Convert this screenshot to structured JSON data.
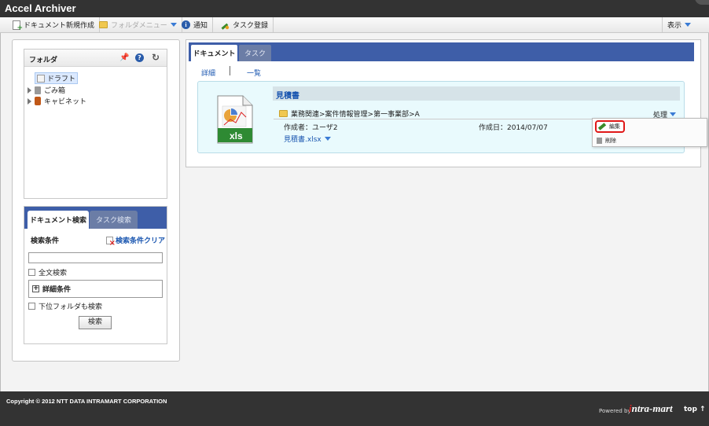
{
  "app": {
    "title": "Accel Archiver"
  },
  "toolbar": {
    "new_document": "ドキュメント新規作成",
    "folder_menu": "フォルダメニュー",
    "notify": "通知",
    "task_register": "タスク登録",
    "display": "表示"
  },
  "folder_panel": {
    "title": "フォルダ",
    "items": [
      {
        "label": "ドラフト",
        "selected": true
      },
      {
        "label": "ごみ箱"
      },
      {
        "label": "キャビネット"
      }
    ]
  },
  "search_panel": {
    "tabs": [
      "ドキュメント検索",
      "タスク検索"
    ],
    "condition_label": "検索条件",
    "clear_label": "検索条件クリア",
    "input_value": "",
    "fulltext_label": "全文検索",
    "detail_label": "詳細条件",
    "subfolder_label": "下位フォルダも検索",
    "search_button": "検索"
  },
  "content": {
    "tabs": [
      "ドキュメント",
      "タスク"
    ],
    "view_detail": "詳細",
    "view_list": "一覧",
    "document": {
      "title": "見積書",
      "path": "業務関連>案件情報管理>第一事業部>A",
      "process_label": "処理",
      "author": "作成者：ユーザ2",
      "created": "作成日：2014/07/07",
      "file": "見積書.xlsx",
      "icon_label": "xls"
    },
    "context_menu": {
      "edit": "編集",
      "delete": "削除"
    }
  },
  "footer": {
    "copyright": "Copyright © 2012 NTT DATA INTRAMART CORPORATION",
    "powered_by": "Powered by",
    "brand_i": "i",
    "brand_rest": "ntra-mart",
    "top_link": "top ↑"
  },
  "colors": {
    "tab_blue": "#3e5ea8",
    "link_blue": "#1a56b0",
    "dark_bar": "#333333",
    "edit_highlight": "#e01818"
  }
}
